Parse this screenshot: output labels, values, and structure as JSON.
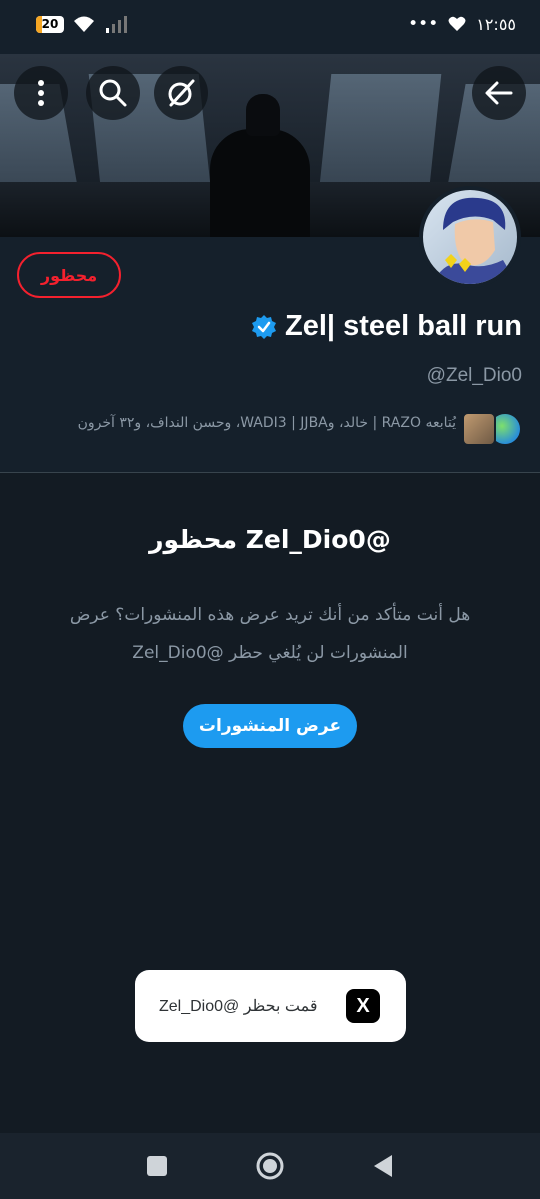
{
  "status_bar": {
    "battery_level": "20",
    "time": "١٢:٥٥",
    "dots": "•••"
  },
  "profile": {
    "display_name": "Zel| steel ball run",
    "handle": "@Zel_Dio0",
    "blocked_label": "محظور",
    "followers_text": "يُتابعه RAZO | خالد، وWADI3 | JJBA، وحسن النداف، و٣٢ آخرون"
  },
  "blocked_notice": {
    "title": "@Zel_Dio0 محظور",
    "description": "هل أنت متأكد من أنك تريد عرض هذه المنشورات؟ عرض المنشورات لن يُلغي حظر @Zel_Dio0",
    "view_posts_label": "عرض المنشورات"
  },
  "toast": {
    "message": "قمت بحظر @Zel_Dio0",
    "logo": "X"
  },
  "icons": {
    "back": "arrow-left-icon",
    "grok": "grok-icon",
    "search": "search-icon",
    "more": "more-vertical-icon",
    "verified": "verified-badge-icon"
  },
  "colors": {
    "background": "#15202b",
    "accent": "#1d9bf0",
    "danger": "#f4212e",
    "muted_text": "#8b98a5"
  }
}
